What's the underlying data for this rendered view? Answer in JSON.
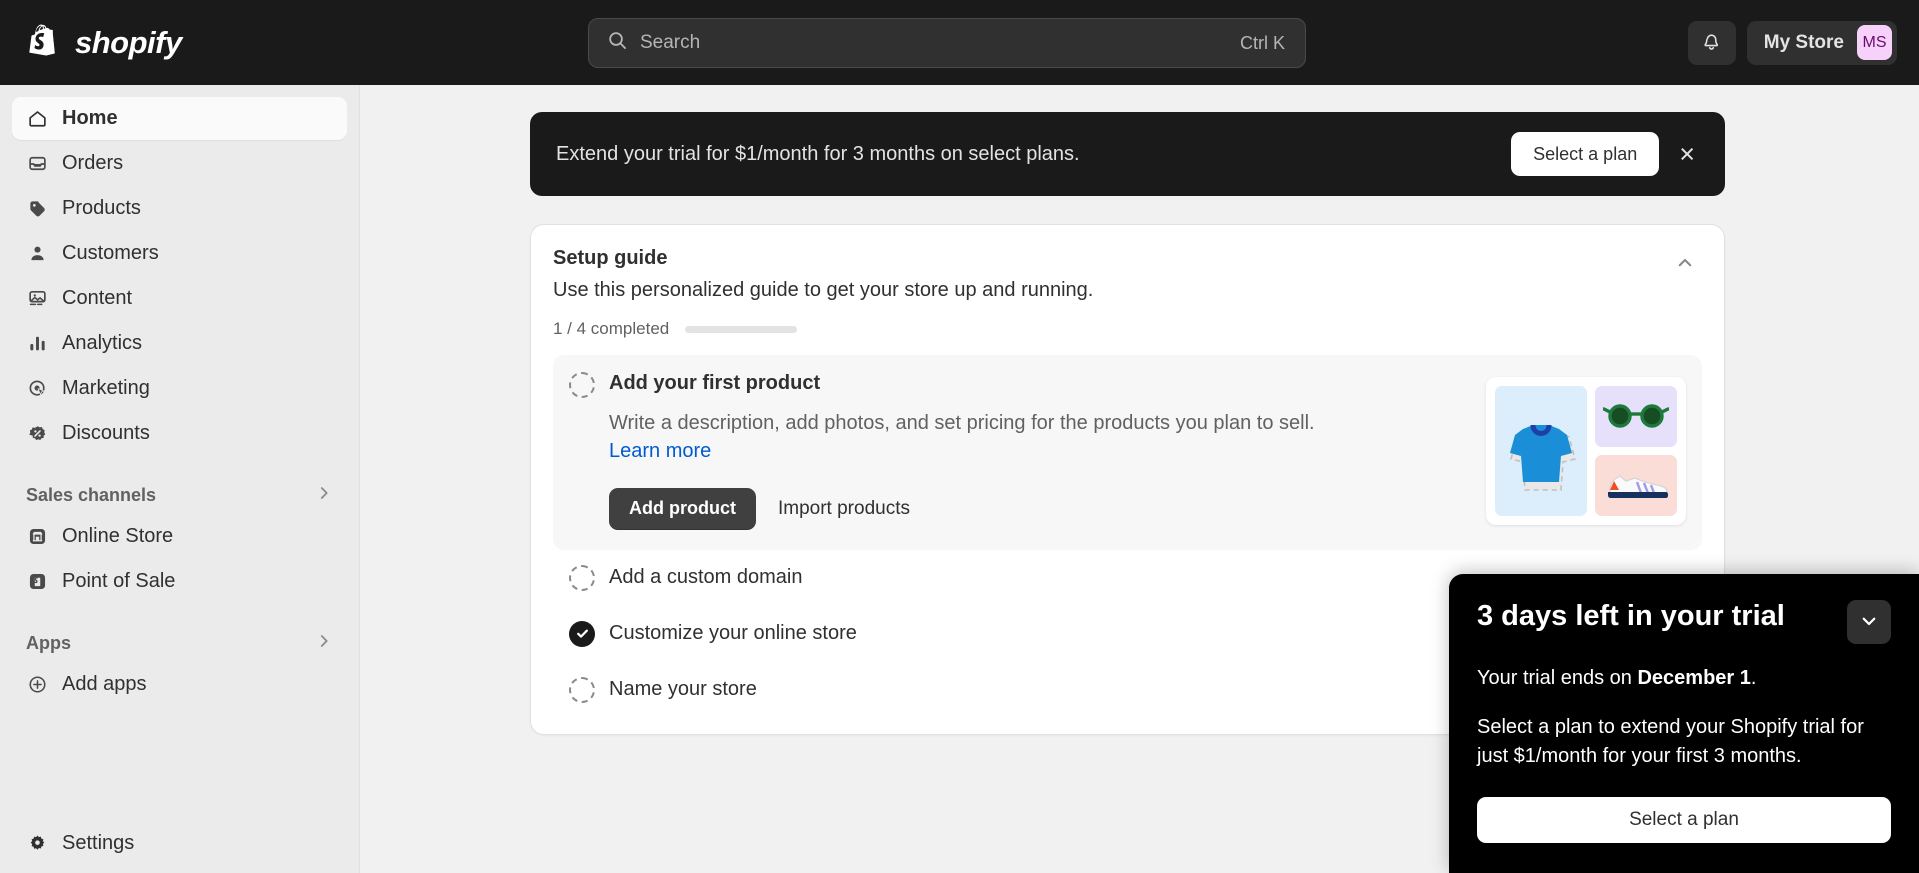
{
  "topbar": {
    "logo_text": "shopify",
    "logo_icon": "shopify-bag-logo",
    "search": {
      "placeholder": "Search",
      "value": "",
      "shortcut": "Ctrl K",
      "icon": "search-icon"
    },
    "notifications_icon": "bell-icon",
    "store_name": "My Store",
    "avatar_initials": "MS",
    "avatar_bg": "#F6D1F9",
    "avatar_fg": "#6A0B6E"
  },
  "sidebar": {
    "items": [
      {
        "label": "Home",
        "icon": "home-icon",
        "active": true
      },
      {
        "label": "Orders",
        "icon": "orders-icon",
        "active": false
      },
      {
        "label": "Products",
        "icon": "products-tag-icon",
        "active": false
      },
      {
        "label": "Customers",
        "icon": "customers-person-icon",
        "active": false
      },
      {
        "label": "Content",
        "icon": "content-image-icon",
        "active": false
      },
      {
        "label": "Analytics",
        "icon": "analytics-bar-chart-icon",
        "active": false
      },
      {
        "label": "Marketing",
        "icon": "marketing-target-icon",
        "active": false
      },
      {
        "label": "Discounts",
        "icon": "discounts-badge-icon",
        "active": false
      }
    ],
    "sections": [
      {
        "label": "Sales channels",
        "chevron": "chevron-right-icon",
        "items": [
          {
            "label": "Online Store",
            "icon": "storefront-icon"
          },
          {
            "label": "Point of Sale",
            "icon": "pos-bag-icon"
          }
        ]
      },
      {
        "label": "Apps",
        "chevron": "chevron-right-icon",
        "items": [
          {
            "label": "Add apps",
            "icon": "plus-circle-icon"
          }
        ]
      }
    ],
    "settings": {
      "label": "Settings",
      "icon": "gear-icon"
    }
  },
  "banner": {
    "text": "Extend your trial for $1/month for 3 months on select plans.",
    "cta_label": "Select a plan",
    "close_icon": "close-icon"
  },
  "setup_guide": {
    "title": "Setup guide",
    "subtitle": "Use this personalized guide to get your store up and running.",
    "progress_label": "1 / 4 completed",
    "progress_completed": 1,
    "progress_total": 4,
    "progress_percent": 25,
    "collapse_icon": "chevron-up-icon",
    "active_task": {
      "title": "Add your first product",
      "description": "Write a description, add photos, and set pricing for the products you plan to sell.",
      "link_label": "Learn more",
      "primary_action": "Add product",
      "secondary_action": "Import products",
      "status_icon": "circle-dashed-icon",
      "illustration": {
        "tshirt_color": "#1A8FD8",
        "tshirt_bg": "#DCEDFB",
        "glasses_color": "#1D7A3C",
        "glasses_bg": "#E7E0FA",
        "shoe_bg": "#FBDDD8"
      }
    },
    "tasks": [
      {
        "label": "Add a custom domain",
        "done": false,
        "status_icon": "circle-dashed-icon"
      },
      {
        "label": "Customize your online store",
        "done": true,
        "status_icon": "circle-check-icon"
      },
      {
        "label": "Name your store",
        "done": false,
        "status_icon": "circle-dashed-icon"
      }
    ]
  },
  "trial_popup": {
    "title": "3 days left in your trial",
    "toggle_icon": "chevron-down-icon",
    "line1_prefix": "Your trial ends on ",
    "line1_bold": "December 1",
    "line1_suffix": ".",
    "line2": "Select a plan to extend your Shopify trial for just $1/month for your first 3 months.",
    "cta_label": "Select a plan"
  }
}
